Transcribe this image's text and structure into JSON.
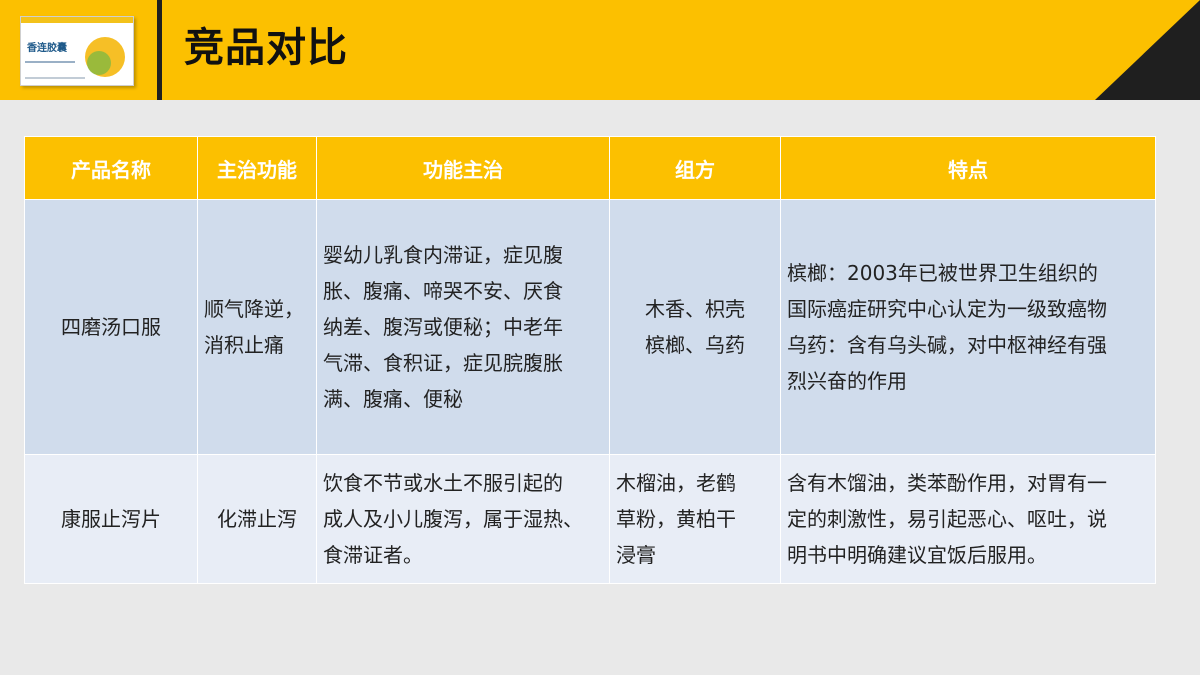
{
  "logo": {
    "text": "香连胶囊",
    "icon": "product-box-logo"
  },
  "title": "竞品对比",
  "colors": {
    "accent": "#fcc000",
    "dark": "#1f1f1f",
    "row1": "#d0dcec",
    "row2": "#e8edf6"
  },
  "table": {
    "headers": [
      "产品名称",
      "主治功能",
      "功能主治",
      "组方",
      "特点"
    ],
    "rows": [
      {
        "name": "四磨汤口服",
        "function": "顺气降逆，\n消积止痛",
        "indications": "婴幼儿乳食内滞证，症见腹\n胀、腹痛、啼哭不安、厌食\n纳差、腹泻或便秘；中老年\n气滞、食积证，症见脘腹胀\n满、腹痛、便秘",
        "formula": "木香、枳壳\n槟榔、乌药",
        "features": "槟榔：2003年已被世界卫生组织的\n国际癌症研究中心认定为一级致癌物\n乌药：含有乌头碱，对中枢神经有强\n烈兴奋的作用"
      },
      {
        "name": "康服止泻片",
        "function": "化滞止泻",
        "indications": "饮食不节或水土不服引起的\n成人及小儿腹泻，属于湿热、\n食滞证者。",
        "formula": "木榴油，老鹤\n草粉，黄柏干\n浸膏",
        "features": "含有木馏油，类苯酚作用，对胃有一\n定的刺激性，易引起恶心、呕吐，说\n明书中明确建议宜饭后服用。"
      }
    ]
  }
}
